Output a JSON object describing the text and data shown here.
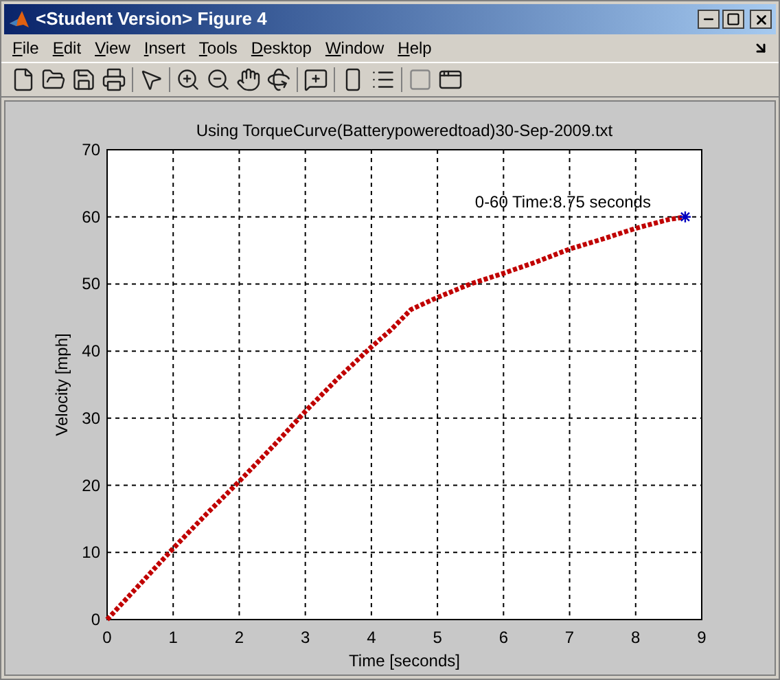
{
  "window": {
    "title": "<Student Version> Figure 4"
  },
  "menu": [
    {
      "label": "File"
    },
    {
      "label": "Edit"
    },
    {
      "label": "View"
    },
    {
      "label": "Insert"
    },
    {
      "label": "Tools"
    },
    {
      "label": "Desktop"
    },
    {
      "label": "Window"
    },
    {
      "label": "Help"
    }
  ],
  "figure": {
    "chart_data": {
      "type": "line",
      "title": "Using TorqueCurve(Batterypoweredtoad)30-Sep-2009.txt",
      "xlabel": "Time [seconds]",
      "ylabel": "Velocity [mph]",
      "x": [
        0,
        0.5,
        1,
        1.5,
        2,
        2.5,
        3,
        3.5,
        4,
        4.3,
        4.6,
        5,
        5.5,
        6,
        6.5,
        7,
        7.5,
        8,
        8.5,
        8.75
      ],
      "grid": true,
      "series": [
        {
          "color": "#c00000",
          "line_style": "dotted",
          "values": [
            0,
            5.3,
            10.6,
            15.7,
            20.6,
            25.7,
            31,
            36,
            40.6,
            43.2,
            46.2,
            48,
            50,
            51.6,
            53.3,
            55.2,
            56.7,
            58.3,
            59.6,
            60
          ]
        },
        {
          "color": "#0000c0",
          "marker": "cross",
          "values": [
            null,
            null,
            null,
            null,
            null,
            null,
            null,
            null,
            null,
            null,
            null,
            null,
            null,
            null,
            null,
            null,
            null,
            null,
            null,
            60
          ]
        }
      ],
      "xlim": [
        0,
        9
      ],
      "ylim": [
        0,
        70
      ],
      "xticks": [
        0,
        1,
        2,
        3,
        4,
        5,
        6,
        7,
        8,
        9
      ],
      "yticks": [
        0,
        10,
        20,
        30,
        40,
        50,
        60,
        70
      ],
      "annotations": [
        "0-60 Time:8.75 seconds"
      ]
    }
  }
}
